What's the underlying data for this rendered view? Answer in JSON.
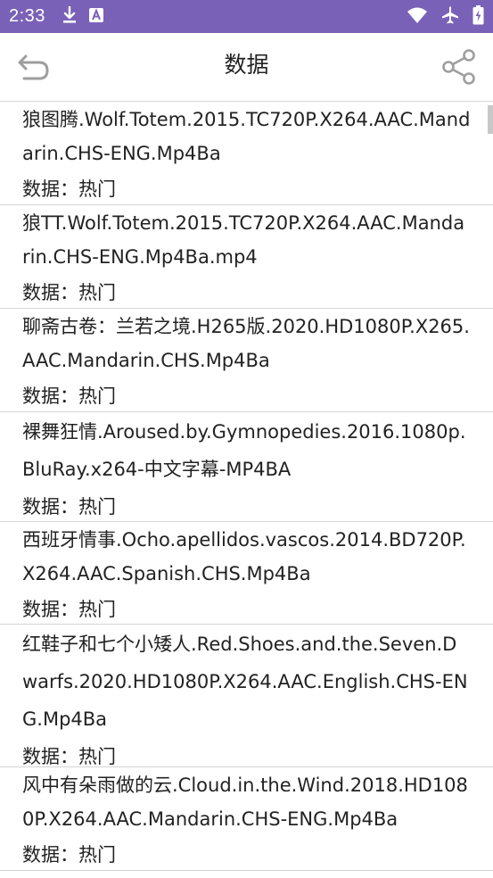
{
  "status_bar": {
    "time": "2:33"
  },
  "header": {
    "title": "数据"
  },
  "items": [
    {
      "title": "狼图腾.Wolf.Totem.2015.TC720P.X264.AAC.Mandarin.CHS-ENG.Mp4Ba",
      "meta": "数据：热门"
    },
    {
      "title": "狼TT.Wolf.Totem.2015.TC720P.X264.AAC.Mandarin.CHS-ENG.Mp4Ba.mp4",
      "meta": "数据：热门"
    },
    {
      "title": "聊斋古卷：兰若之境.H265版.2020.HD1080P.X265.AAC.Mandarin.CHS.Mp4Ba",
      "meta": "数据：热门"
    },
    {
      "title": "裸舞狂情.Aroused.by.Gymnopedies.2016.1080p.BluRay.x264-中文字幕-MP4BA",
      "meta": "数据：热门"
    },
    {
      "title": "西班牙情事.Ocho.apellidos.vascos.2014.BD720P.X264.AAC.Spanish.CHS.Mp4Ba",
      "meta": "数据：热门"
    },
    {
      "title": "红鞋子和七个小矮人.Red.Shoes.and.the.Seven.Dwarfs.2020.HD1080P.X264.AAC.English.CHS-ENG.Mp4Ba",
      "meta": "数据：热门"
    },
    {
      "title": "风中有朵雨做的云.Cloud.in.the.Wind.2018.HD1080P.X264.AAC.Mandarin.CHS-ENG.Mp4Ba",
      "meta": "数据：热门"
    },
    {
      "title": "",
      "meta": ""
    }
  ],
  "colors": {
    "status_bar": "#7a61b8",
    "divider": "#d4d4d4",
    "icon_gray": "#9e9e9e"
  },
  "icons": {
    "back": "back-arrow-icon",
    "share": "share-icon"
  }
}
